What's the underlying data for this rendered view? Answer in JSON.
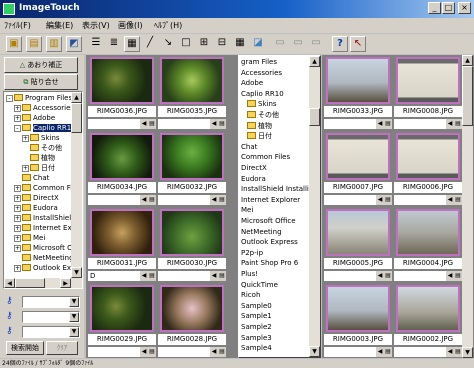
{
  "window": {
    "title": "ImageTouch",
    "min": "_",
    "max": "□",
    "close": "×"
  },
  "menu": [
    "ﾌｧｲﾙ(F)",
    "編集(E)",
    "表示(V)",
    "画像(I)",
    "ﾍﾙﾌﾟ(H)"
  ],
  "left": {
    "btn_correct": "あおり補正",
    "btn_stitch": "貼り合せ",
    "search_button": "検索開始",
    "clear_button": "ｸﾘｱ",
    "tree": [
      {
        "label": "Program Files",
        "level": 0,
        "expander": "-"
      },
      {
        "label": "Accessories",
        "level": 1,
        "expander": "+"
      },
      {
        "label": "Adobe",
        "level": 1,
        "expander": "+"
      },
      {
        "label": "Caplio RR10",
        "level": 1,
        "expander": "-",
        "selected": true
      },
      {
        "label": "Skins",
        "level": 2,
        "expander": "+"
      },
      {
        "label": "その他",
        "level": 2,
        "expander": ""
      },
      {
        "label": "植物",
        "level": 2,
        "expander": ""
      },
      {
        "label": "日付",
        "level": 2,
        "expander": "+"
      },
      {
        "label": "Chat",
        "level": 1,
        "expander": ""
      },
      {
        "label": "Common Files",
        "level": 1,
        "expander": "+"
      },
      {
        "label": "DirectX",
        "level": 1,
        "expander": "+"
      },
      {
        "label": "Eudora",
        "level": 1,
        "expander": "+"
      },
      {
        "label": "InstallShield",
        "level": 1,
        "expander": "+"
      },
      {
        "label": "Internet Explorer",
        "level": 1,
        "expander": "+"
      },
      {
        "label": "Mei",
        "level": 1,
        "expander": "+"
      },
      {
        "label": "Microsoft Office",
        "level": 1,
        "expander": "+"
      },
      {
        "label": "NetMeeting",
        "level": 1,
        "expander": ""
      },
      {
        "label": "Outlook Express",
        "level": 1,
        "expander": "+"
      }
    ]
  },
  "floattree": [
    "gram Files",
    "Accessories",
    "Adobe",
    "Caplio RR10",
    "Skins",
    "その他",
    "植物",
    "日付",
    "Chat",
    "Common Files",
    "DirectX",
    "Eudora",
    "InstallShield Installi",
    "Internet Explorer",
    "Mei",
    "Microsoft Office",
    "NetMeeting",
    "Outlook Express",
    "P2p-ip",
    "Paint Shop Pro 6",
    "Plus!",
    "QuickTime",
    "Ricoh",
    "Sample0",
    "Sample1",
    "Sample2",
    "Sample3",
    "Sample4"
  ],
  "pane1": [
    {
      "file": "RIMG0036.JPG",
      "memo": "",
      "photo": "plant-dark"
    },
    {
      "file": "RIMG0035.JPG",
      "memo": "",
      "photo": "plant-bright"
    },
    {
      "file": "RIMG0034.JPG",
      "memo": "",
      "photo": "plant-spiky"
    },
    {
      "file": "RIMG0032.JPG",
      "memo": "",
      "photo": "plant-green"
    },
    {
      "file": "RIMG0031.JPG",
      "memo": "D",
      "photo": "plant-dried"
    },
    {
      "file": "RIMG0030.JPG",
      "memo": "",
      "photo": "plant-leafy"
    },
    {
      "file": "RIMG0029.JPG",
      "memo": "",
      "photo": "plant-dark"
    },
    {
      "file": "RIMG0028.JPG",
      "memo": "",
      "photo": "plant-pink"
    }
  ],
  "pane2": [
    {
      "file": "RIMG0033.JPG",
      "memo": "",
      "photo": "tree-sky"
    },
    {
      "file": "RIMG0008.JPG",
      "memo": "",
      "photo": "frame-sketch"
    },
    {
      "file": "RIMG0007.JPG",
      "memo": "",
      "photo": "frame-sketch"
    },
    {
      "file": "RIMG0006.JPG",
      "memo": "",
      "photo": "frame-sketch"
    },
    {
      "file": "RIMG0005.JPG",
      "memo": "",
      "photo": "building"
    },
    {
      "file": "RIMG0004.JPG",
      "memo": "",
      "photo": "building-tree"
    },
    {
      "file": "RIMG0003.JPG",
      "memo": "",
      "photo": "tree-sky"
    },
    {
      "file": "RIMG0002.JPG",
      "memo": "",
      "photo": "tree-bare"
    }
  ],
  "status": "24個のﾌｧｲﾙ / ｻﾌﾞﾌｫﾙﾀﾞ 9個のﾌｧｲﾙ"
}
